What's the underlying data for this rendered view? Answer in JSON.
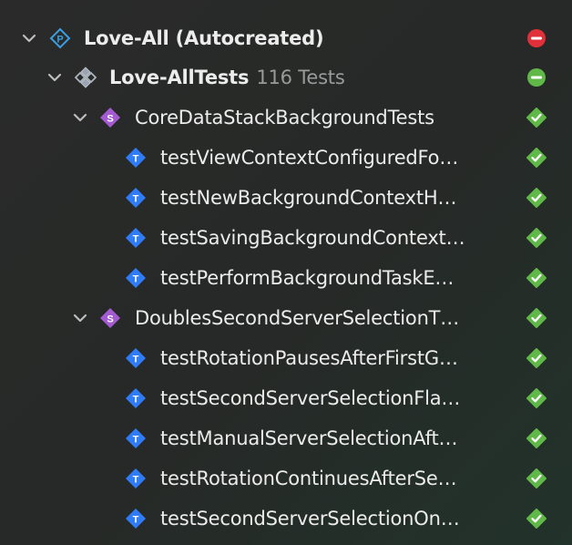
{
  "project": {
    "name": "Love-All (Autocreated)",
    "icon_letter": "P",
    "icon": "test-plan-diamond-icon",
    "status": "failed"
  },
  "target": {
    "name": "Love-AllTests",
    "count_label": "116 Tests",
    "icon": "test-bundle-icon",
    "status": "mixed"
  },
  "suites": [
    {
      "name": "CoreDataStackBackgroundTests",
      "icon_letter": "S",
      "status": "passed",
      "tests": [
        {
          "name": "testViewContextConfiguredFo…",
          "icon_letter": "T",
          "status": "passed"
        },
        {
          "name": "testNewBackgroundContextH…",
          "icon_letter": "T",
          "status": "passed"
        },
        {
          "name": "testSavingBackgroundContext…",
          "icon_letter": "T",
          "status": "passed"
        },
        {
          "name": "testPerformBackgroundTaskE…",
          "icon_letter": "T",
          "status": "passed"
        }
      ]
    },
    {
      "name": "DoublesSecondServerSelectionT…",
      "icon_letter": "S",
      "status": "passed",
      "tests": [
        {
          "name": "testRotationPausesAfterFirstG…",
          "icon_letter": "T",
          "status": "passed"
        },
        {
          "name": "testSecondServerSelectionFla…",
          "icon_letter": "T",
          "status": "passed"
        },
        {
          "name": "testManualServerSelectionAft…",
          "icon_letter": "T",
          "status": "passed"
        },
        {
          "name": "testRotationContinuesAfterSe…",
          "icon_letter": "T",
          "status": "passed"
        },
        {
          "name": "testSecondServerSelectionOn…",
          "icon_letter": "T",
          "status": "passed"
        }
      ]
    }
  ],
  "colors": {
    "failed": "#e0313a",
    "passed": "#5fb847",
    "suite_icon": "#a55bd0",
    "test_icon": "#2f7cf6",
    "plan_icon": "#3b9ee0"
  }
}
